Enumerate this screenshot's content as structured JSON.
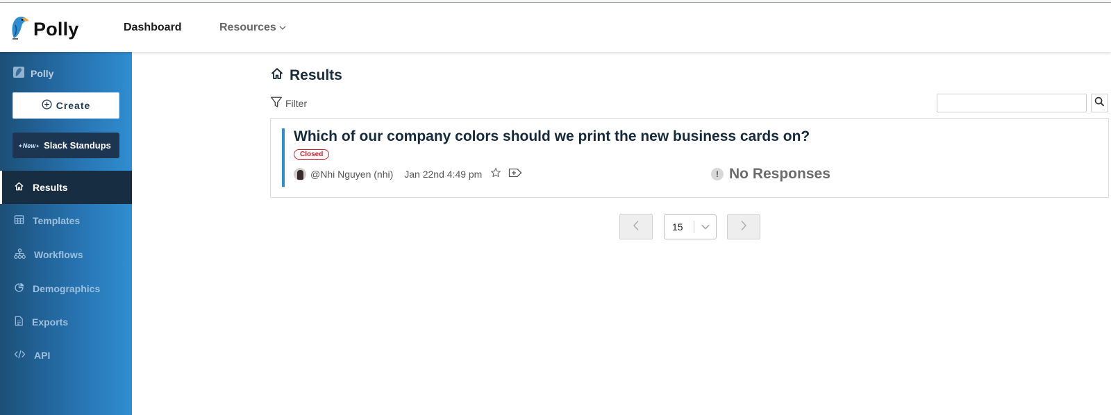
{
  "header": {
    "logo_text": "Polly",
    "nav": {
      "dashboard": "Dashboard",
      "resources": "Resources"
    }
  },
  "sidebar": {
    "brand": "Polly",
    "create_label": "Create",
    "slack": {
      "new_tag": "New",
      "label": "Slack Standups"
    },
    "items": [
      {
        "label": "Results",
        "icon": "home-icon",
        "active": true
      },
      {
        "label": "Templates",
        "icon": "table-icon",
        "active": false
      },
      {
        "label": "Workflows",
        "icon": "workflow-icon",
        "active": false
      },
      {
        "label": "Demographics",
        "icon": "pie-icon",
        "active": false
      },
      {
        "label": "Exports",
        "icon": "export-icon",
        "active": false
      },
      {
        "label": "API",
        "icon": "code-icon",
        "active": false
      }
    ]
  },
  "main": {
    "title": "Results",
    "filter_label": "Filter",
    "search": {
      "value": "",
      "placeholder": ""
    },
    "poll": {
      "title": "Which of our company colors should we print the new business cards on?",
      "status": "Closed",
      "author": "@Nhi Nguyen (nhi)",
      "date": "Jan 22nd 4:49 pm",
      "responses": "No Responses"
    },
    "pagination": {
      "page_size": "15"
    }
  },
  "colors": {
    "sidebar_dark": "#1c4f78",
    "sidebar_light": "#2f8ed2",
    "active_item": "#162d42",
    "accent": "#2f8ed2",
    "closed": "#d21f2e"
  }
}
